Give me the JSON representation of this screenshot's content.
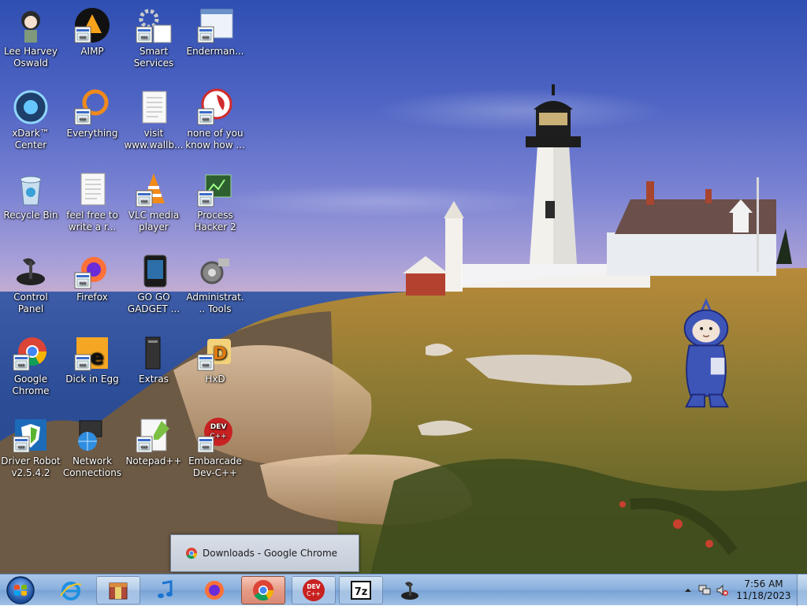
{
  "desktop": {
    "icons": [
      {
        "label": "Lee Harvey Oswald",
        "icon": "anime-girl-icon"
      },
      {
        "label": "AIMP",
        "icon": "aimp-icon"
      },
      {
        "label": "Smart Services",
        "icon": "gear-shortcut-icon"
      },
      {
        "label": "Enderman...",
        "icon": "window-app-icon"
      },
      {
        "label": "xDark™ Center",
        "icon": "xdark-orb-icon"
      },
      {
        "label": "Everything",
        "icon": "everything-search-icon"
      },
      {
        "label": "visit www.wallb...",
        "icon": "text-document-icon"
      },
      {
        "label": "none of you know how ...",
        "icon": "red-app-icon"
      },
      {
        "label": "Recycle Bin",
        "icon": "recycle-bin-icon"
      },
      {
        "label": "feel free to write a r...",
        "icon": "text-document-icon"
      },
      {
        "label": "VLC media player",
        "icon": "vlc-cone-icon"
      },
      {
        "label": "Process Hacker 2",
        "icon": "process-hacker-icon"
      },
      {
        "label": "Control Panel",
        "icon": "control-panel-icon"
      },
      {
        "label": "Firefox",
        "icon": "firefox-icon"
      },
      {
        "label": "GO GO GADGET ...",
        "icon": "gadget-panel-icon"
      },
      {
        "label": "Administrat... Tools",
        "icon": "admin-tools-icon"
      },
      {
        "label": "Google Chrome",
        "icon": "chrome-icon"
      },
      {
        "label": "Dick in Egg",
        "icon": "egg-app-icon"
      },
      {
        "label": "Extras",
        "icon": "pc-tower-icon"
      },
      {
        "label": "HxD",
        "icon": "hxd-icon"
      },
      {
        "label": "Driver Robot v2.5.4.2",
        "icon": "driver-shield-icon"
      },
      {
        "label": "Network Connections",
        "icon": "network-globe-icon"
      },
      {
        "label": "Notepad++",
        "icon": "notepad-plus-icon"
      },
      {
        "label": "Embarcade Dev-C++",
        "icon": "devcpp-icon"
      }
    ]
  },
  "tooltip": {
    "text": "Downloads - Google Chrome",
    "icon": "chrome-icon"
  },
  "taskbar": {
    "start": "windows-orb-icon",
    "buttons": [
      {
        "icon": "internet-explorer-icon"
      },
      {
        "icon": "archive-app-icon"
      },
      {
        "icon": "music-note-icon"
      },
      {
        "icon": "firefox-icon"
      },
      {
        "icon": "chrome-icon",
        "active": true
      },
      {
        "icon": "devcpp-icon",
        "text": "DEV C++"
      },
      {
        "icon": "7zip-icon",
        "text": "7z"
      },
      {
        "icon": "control-panel-icon"
      }
    ],
    "tray": {
      "time": "7:56 AM",
      "date": "11/18/2023",
      "icons": [
        "show-hidden-chevron-icon",
        "network-icon",
        "speaker-muted-icon"
      ]
    }
  },
  "colors": {
    "sky": "#4f65c4",
    "taskbar": "#8cb2de",
    "chrome_red": "#db4437",
    "chrome_green": "#0f9d58",
    "chrome_yellow": "#f4b400",
    "chrome_blue": "#4285f4"
  }
}
